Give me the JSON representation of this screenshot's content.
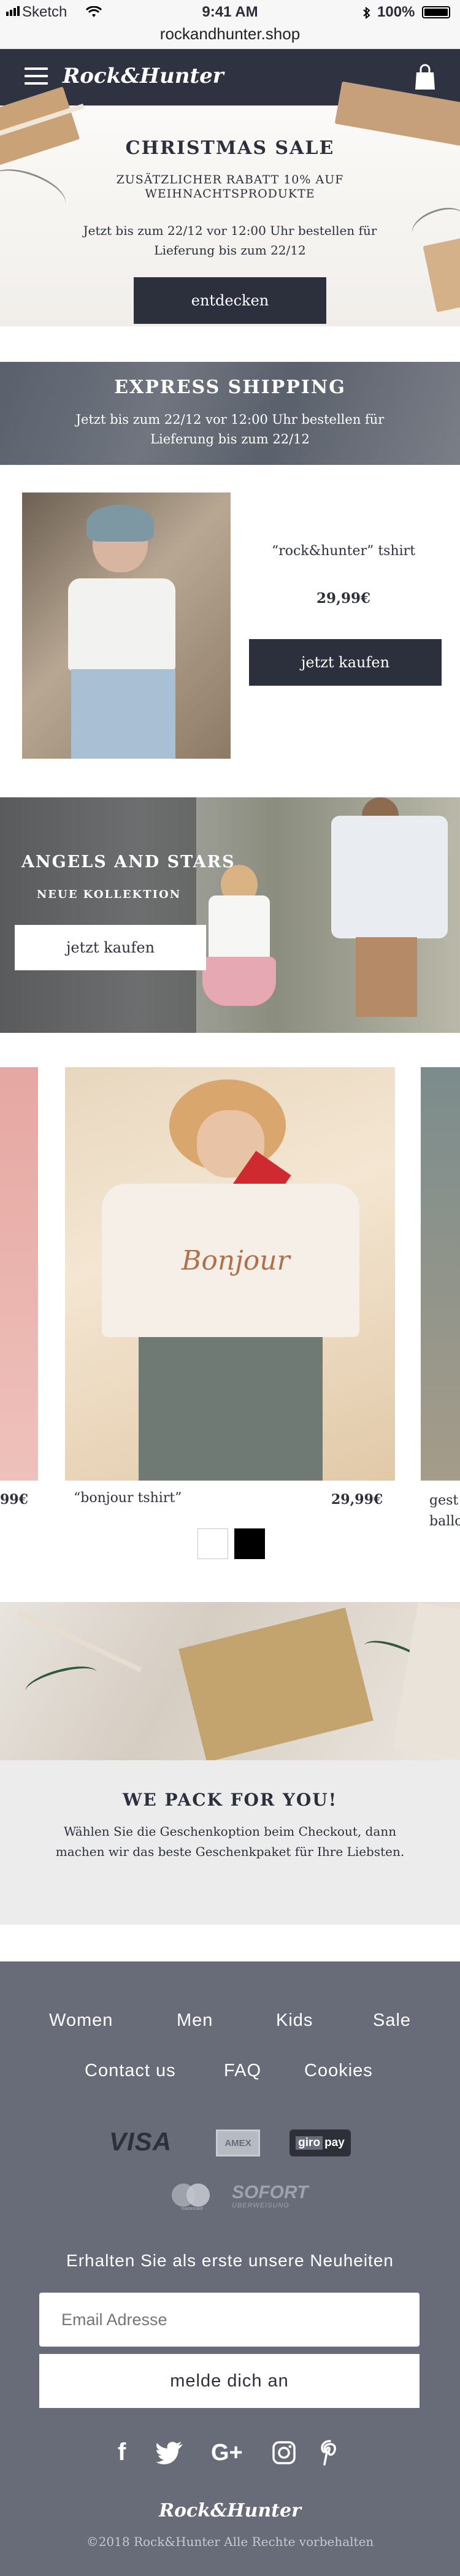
{
  "status_bar": {
    "carrier": "Sketch",
    "time": "9:41 AM",
    "battery": "100%"
  },
  "browser": {
    "url": "rockandhunter.shop"
  },
  "nav": {
    "logo": "Rock&Hunter"
  },
  "christmas": {
    "title": "CHRISTMAS SALE",
    "subtitle": "ZUSÄTZLICHER RABATT 10% AUF WEIHNACHTSPRODUKTE",
    "text": "Jetzt bis zum 22/12 vor 12:00 Uhr bestellen für Lieferung bis zum 22/12",
    "button": "entdecken"
  },
  "express": {
    "title": "EXPRESS SHIPPING",
    "text": "Jetzt bis zum 22/12 vor 12:00 Uhr bestellen für Lieferung bis zum 22/12"
  },
  "product_feature": {
    "name": "“rock&hunter” tshirt",
    "price": "29,99€",
    "button": "jetzt kaufen"
  },
  "angels": {
    "title": "ANGELS AND STARS",
    "subtitle": "NEUE KOLLEKTION",
    "button": "jetzt kaufen"
  },
  "carousel": {
    "prev_price": "99€",
    "name": "“bonjour tshirt”",
    "price": "29,99€",
    "shirt_print": "Bonjour",
    "next_name_line1": "gest",
    "next_name_line2": "ballo",
    "swatches": [
      "#ffffff",
      "#000000"
    ]
  },
  "pack": {
    "title": "WE PACK FOR YOU!",
    "text": "Wählen Sie die Geschenkoption beim Checkout, dann machen wir das beste Geschenkpaket für Ihre Liebsten."
  },
  "footer": {
    "links_row1": [
      "Women",
      "Men",
      "Kids",
      "Sale"
    ],
    "links_row2": [
      "Contact us",
      "FAQ",
      "Cookies"
    ],
    "payments": {
      "visa": "VISA",
      "amex": "AMEX",
      "giropay_a": "giro",
      "giropay_b": "pay",
      "sofort": "SOFORT",
      "sofort_sub": "ÜBERWEISUNG",
      "mastercard": "mastercard"
    },
    "newsletter_title": "Erhalten Sie als erste unsere Neuheiten",
    "email_placeholder": "Email Adresse",
    "subscribe_button": "melde dich an",
    "social": [
      "f",
      "G+"
    ],
    "logo": "Rock&Hunter",
    "copyright": "©2018 Rock&Hunter Alle Rechte vorbehalten"
  },
  "colors": {
    "navy": "#2f3341",
    "footer_bg": "#676c78",
    "express_bg": "#5f6571",
    "pack_bg": "#ececec"
  }
}
